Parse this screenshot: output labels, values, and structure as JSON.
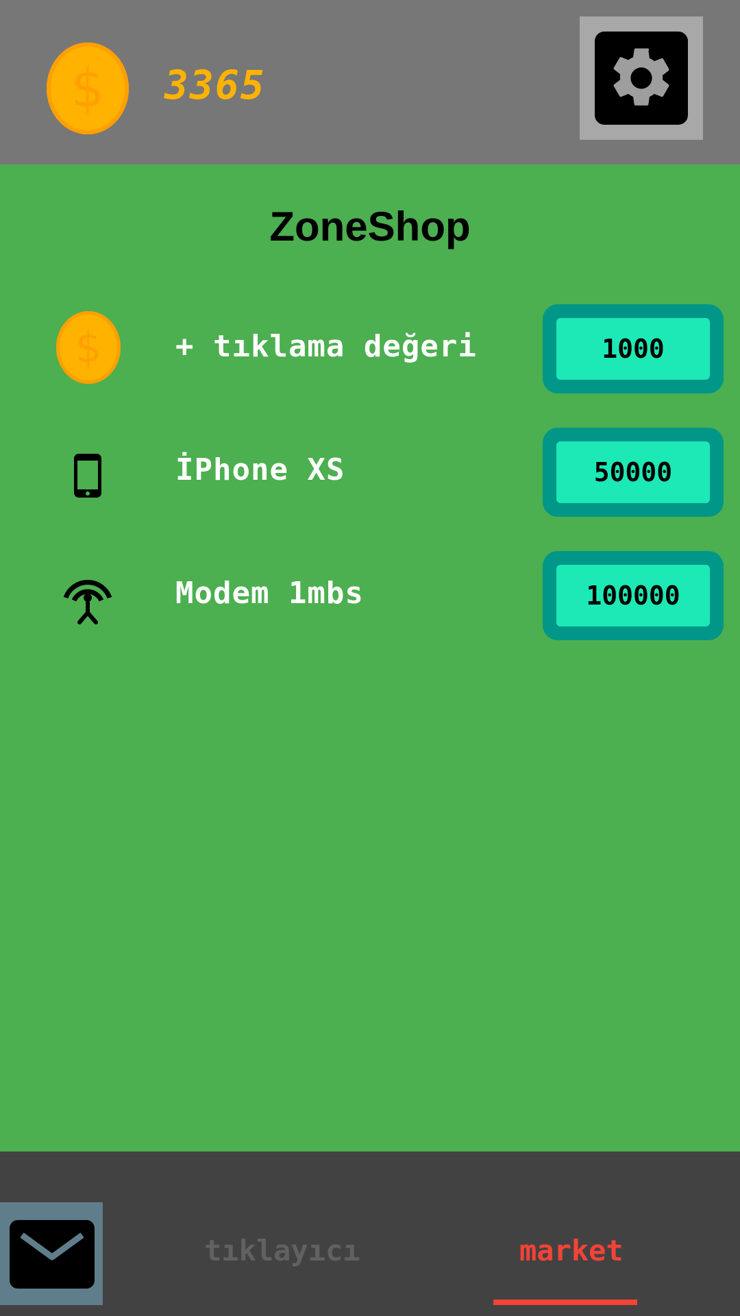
{
  "header": {
    "coin_icon": "coin-icon",
    "coin_count": "3365",
    "settings_icon": "gear-icon"
  },
  "shop": {
    "title": "ZoneShop",
    "items": [
      {
        "icon": "coin-icon",
        "label": "+ tıklama değeri",
        "price": "1000"
      },
      {
        "icon": "phone-icon",
        "label": "İPhone XS",
        "price": "50000"
      },
      {
        "icon": "antenna-icon",
        "label": "Modem 1mbs",
        "price": "100000"
      }
    ]
  },
  "bottom_nav": {
    "mail_icon": "mail-icon",
    "tabs": [
      {
        "label": "tıklayıcı",
        "active": false
      },
      {
        "label": "market",
        "active": true
      }
    ]
  },
  "colors": {
    "background": "#4caf50",
    "header": "#777777",
    "coin": "#ffb300",
    "button_outer": "#009688",
    "button_inner": "#1de9b6",
    "active_tab": "#f44336",
    "bottom_bar": "#424242"
  }
}
